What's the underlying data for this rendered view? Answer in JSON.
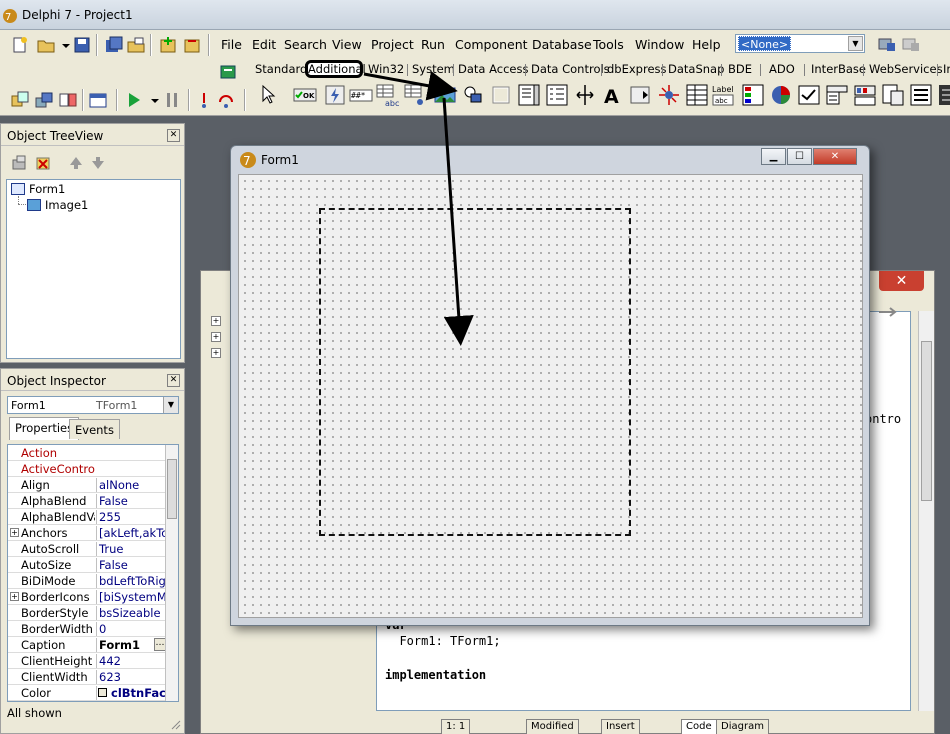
{
  "window": {
    "title": "Delphi 7 - Project1"
  },
  "menu": [
    "File",
    "Edit",
    "Search",
    "View",
    "Project",
    "Run",
    "Component",
    "Database",
    "Tools",
    "Window",
    "Help"
  ],
  "config_select": {
    "value": "<None>"
  },
  "palette": {
    "tabs": [
      "Standard",
      "Additional",
      "Win32",
      "System",
      "Data Access",
      "Data Controls",
      "dbExpress",
      "DataSnap",
      "BDE",
      "ADO",
      "InterBase",
      "WebServices",
      "In"
    ],
    "selected_tab": "Additional",
    "icon_texts": {
      "ok_button": "OK",
      "label": "Label",
      "abc": "abc"
    }
  },
  "tree_view": {
    "title": "Object TreeView",
    "items": [
      {
        "label": "Form1",
        "level": 0
      },
      {
        "label": "Image1",
        "level": 1
      }
    ]
  },
  "object_inspector": {
    "title": "Object Inspector",
    "object_name": "Form1",
    "object_type": "TForm1",
    "tabs": [
      "Properties",
      "Events"
    ],
    "properties": [
      {
        "name": "Action",
        "value": "",
        "kind": "event"
      },
      {
        "name": "ActiveControl",
        "value": "",
        "kind": "event"
      },
      {
        "name": "Align",
        "value": "alNone"
      },
      {
        "name": "AlphaBlend",
        "value": "False"
      },
      {
        "name": "AlphaBlendValu",
        "value": "255"
      },
      {
        "name": "Anchors",
        "value": "[akLeft,akTop",
        "expandable": true
      },
      {
        "name": "AutoScroll",
        "value": "True"
      },
      {
        "name": "AutoSize",
        "value": "False"
      },
      {
        "name": "BiDiMode",
        "value": "bdLeftToRight"
      },
      {
        "name": "BorderIcons",
        "value": "[biSystemMen",
        "expandable": true
      },
      {
        "name": "BorderStyle",
        "value": "bsSizeable"
      },
      {
        "name": "BorderWidth",
        "value": "0"
      },
      {
        "name": "Caption",
        "value": "Form1",
        "selected": true
      },
      {
        "name": "ClientHeight",
        "value": "442"
      },
      {
        "name": "ClientWidth",
        "value": "623"
      },
      {
        "name": "Color",
        "value": "clBtnFace"
      }
    ],
    "status": "All shown"
  },
  "editor": {
    "close_label": "✕",
    "code_lines": [
      {
        "text": "ontro",
        "bold": false
      },
      {
        "text": "var",
        "bold": true
      },
      {
        "text": "  Form1: TForm1;",
        "bold": false
      },
      {
        "text": "implementation",
        "bold": true
      }
    ],
    "bottom_tabs": [
      "1: 1",
      "Modified",
      "Insert",
      "Code",
      "Diagram"
    ]
  },
  "form_designer": {
    "title": "Form1",
    "buttons": {
      "minimize": "▁",
      "maximize": "☐",
      "close": "✕"
    }
  }
}
